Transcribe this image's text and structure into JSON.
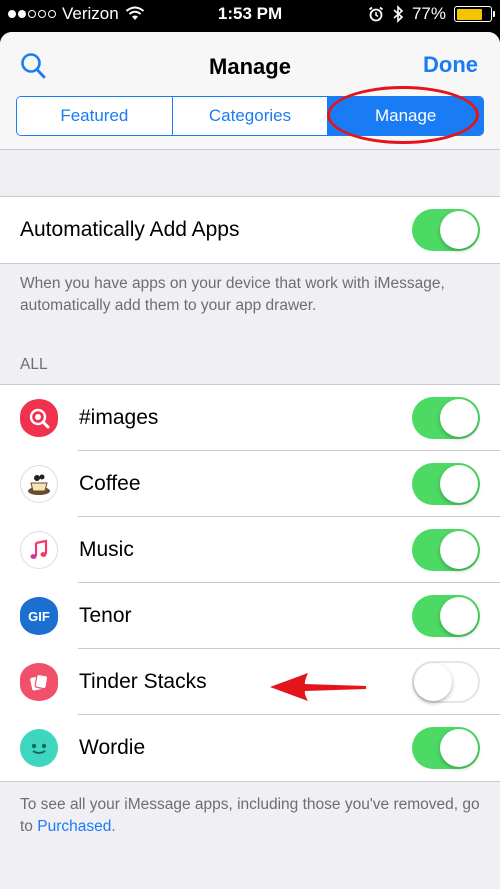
{
  "status_bar": {
    "carrier": "Verizon",
    "time": "1:53 PM",
    "battery": "77%",
    "battery_level": 0.77
  },
  "nav": {
    "title": "Manage",
    "done_label": "Done"
  },
  "segments": [
    {
      "label": "Featured",
      "active": false
    },
    {
      "label": "Categories",
      "active": false
    },
    {
      "label": "Manage",
      "active": true
    }
  ],
  "auto_add": {
    "label": "Automatically Add Apps",
    "enabled": true,
    "footnote": "When you have apps on your device that work with iMessage, automatically add them to your app drawer."
  },
  "section_header": "ALL",
  "apps": [
    {
      "name": "#images",
      "icon": "images-icon",
      "enabled": true
    },
    {
      "name": "Coffee",
      "icon": "coffee-icon",
      "enabled": true
    },
    {
      "name": "Music",
      "icon": "music-icon",
      "enabled": true
    },
    {
      "name": "Tenor",
      "icon": "tenor-icon",
      "icon_text": "GIF",
      "enabled": true
    },
    {
      "name": "Tinder Stacks",
      "icon": "tinder-stacks-icon",
      "enabled": false
    },
    {
      "name": "Wordie",
      "icon": "wordie-icon",
      "enabled": true
    }
  ],
  "footer": {
    "text": "To see all your iMessage apps, including those you've removed, go to ",
    "link": "Purchased",
    "end": "."
  },
  "colors": {
    "accent": "#1a7cf5",
    "switch_on": "#4cd964",
    "annotation": "#e3151b"
  }
}
